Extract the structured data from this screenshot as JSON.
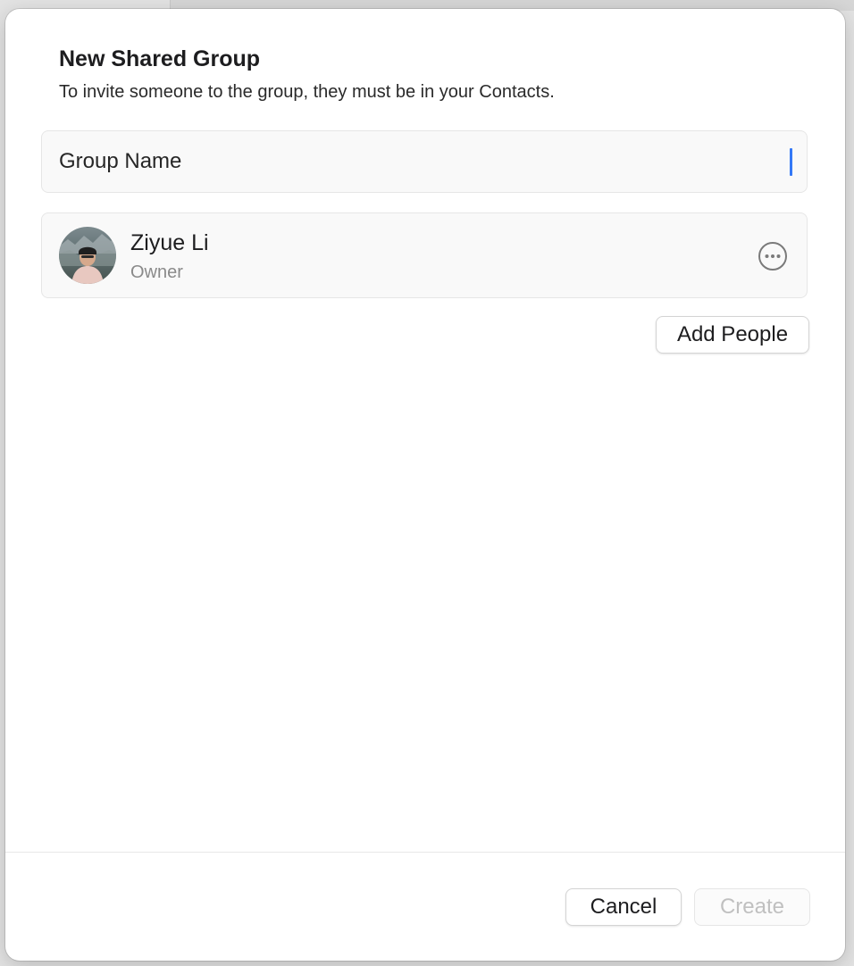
{
  "dialog": {
    "title": "New Shared Group",
    "subtitle": "To invite someone to the group, they must be in your Contacts."
  },
  "group_name_field": {
    "placeholder": "Group Name",
    "value": "",
    "focused": true,
    "caret_color": "#3478f6"
  },
  "members": [
    {
      "name": "Ziyue Li",
      "role": "Owner",
      "avatar_icon": "user-photo",
      "more_icon": "ellipsis-circle-icon"
    }
  ],
  "add_people_label": "Add People",
  "footer": {
    "cancel_label": "Cancel",
    "create_label": "Create",
    "create_enabled": false
  },
  "colors": {
    "accent": "#3478f6",
    "disabled_text": "#c0c0c0"
  }
}
